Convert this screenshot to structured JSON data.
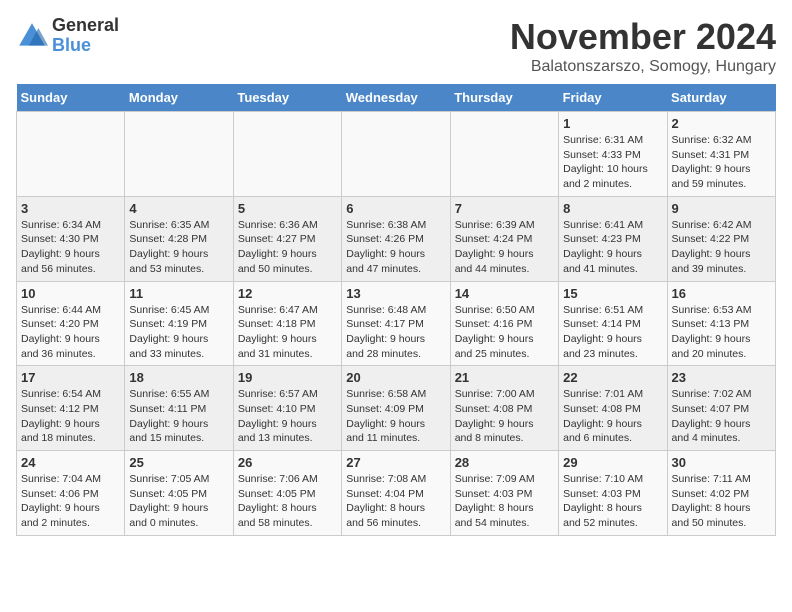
{
  "logo": {
    "general": "General",
    "blue": "Blue"
  },
  "title": "November 2024",
  "subtitle": "Balatonszarszo, Somogy, Hungary",
  "headers": [
    "Sunday",
    "Monday",
    "Tuesday",
    "Wednesday",
    "Thursday",
    "Friday",
    "Saturday"
  ],
  "weeks": [
    [
      {
        "day": "",
        "info": ""
      },
      {
        "day": "",
        "info": ""
      },
      {
        "day": "",
        "info": ""
      },
      {
        "day": "",
        "info": ""
      },
      {
        "day": "",
        "info": ""
      },
      {
        "day": "1",
        "info": "Sunrise: 6:31 AM\nSunset: 4:33 PM\nDaylight: 10 hours\nand 2 minutes."
      },
      {
        "day": "2",
        "info": "Sunrise: 6:32 AM\nSunset: 4:31 PM\nDaylight: 9 hours\nand 59 minutes."
      }
    ],
    [
      {
        "day": "3",
        "info": "Sunrise: 6:34 AM\nSunset: 4:30 PM\nDaylight: 9 hours\nand 56 minutes."
      },
      {
        "day": "4",
        "info": "Sunrise: 6:35 AM\nSunset: 4:28 PM\nDaylight: 9 hours\nand 53 minutes."
      },
      {
        "day": "5",
        "info": "Sunrise: 6:36 AM\nSunset: 4:27 PM\nDaylight: 9 hours\nand 50 minutes."
      },
      {
        "day": "6",
        "info": "Sunrise: 6:38 AM\nSunset: 4:26 PM\nDaylight: 9 hours\nand 47 minutes."
      },
      {
        "day": "7",
        "info": "Sunrise: 6:39 AM\nSunset: 4:24 PM\nDaylight: 9 hours\nand 44 minutes."
      },
      {
        "day": "8",
        "info": "Sunrise: 6:41 AM\nSunset: 4:23 PM\nDaylight: 9 hours\nand 41 minutes."
      },
      {
        "day": "9",
        "info": "Sunrise: 6:42 AM\nSunset: 4:22 PM\nDaylight: 9 hours\nand 39 minutes."
      }
    ],
    [
      {
        "day": "10",
        "info": "Sunrise: 6:44 AM\nSunset: 4:20 PM\nDaylight: 9 hours\nand 36 minutes."
      },
      {
        "day": "11",
        "info": "Sunrise: 6:45 AM\nSunset: 4:19 PM\nDaylight: 9 hours\nand 33 minutes."
      },
      {
        "day": "12",
        "info": "Sunrise: 6:47 AM\nSunset: 4:18 PM\nDaylight: 9 hours\nand 31 minutes."
      },
      {
        "day": "13",
        "info": "Sunrise: 6:48 AM\nSunset: 4:17 PM\nDaylight: 9 hours\nand 28 minutes."
      },
      {
        "day": "14",
        "info": "Sunrise: 6:50 AM\nSunset: 4:16 PM\nDaylight: 9 hours\nand 25 minutes."
      },
      {
        "day": "15",
        "info": "Sunrise: 6:51 AM\nSunset: 4:14 PM\nDaylight: 9 hours\nand 23 minutes."
      },
      {
        "day": "16",
        "info": "Sunrise: 6:53 AM\nSunset: 4:13 PM\nDaylight: 9 hours\nand 20 minutes."
      }
    ],
    [
      {
        "day": "17",
        "info": "Sunrise: 6:54 AM\nSunset: 4:12 PM\nDaylight: 9 hours\nand 18 minutes."
      },
      {
        "day": "18",
        "info": "Sunrise: 6:55 AM\nSunset: 4:11 PM\nDaylight: 9 hours\nand 15 minutes."
      },
      {
        "day": "19",
        "info": "Sunrise: 6:57 AM\nSunset: 4:10 PM\nDaylight: 9 hours\nand 13 minutes."
      },
      {
        "day": "20",
        "info": "Sunrise: 6:58 AM\nSunset: 4:09 PM\nDaylight: 9 hours\nand 11 minutes."
      },
      {
        "day": "21",
        "info": "Sunrise: 7:00 AM\nSunset: 4:08 PM\nDaylight: 9 hours\nand 8 minutes."
      },
      {
        "day": "22",
        "info": "Sunrise: 7:01 AM\nSunset: 4:08 PM\nDaylight: 9 hours\nand 6 minutes."
      },
      {
        "day": "23",
        "info": "Sunrise: 7:02 AM\nSunset: 4:07 PM\nDaylight: 9 hours\nand 4 minutes."
      }
    ],
    [
      {
        "day": "24",
        "info": "Sunrise: 7:04 AM\nSunset: 4:06 PM\nDaylight: 9 hours\nand 2 minutes."
      },
      {
        "day": "25",
        "info": "Sunrise: 7:05 AM\nSunset: 4:05 PM\nDaylight: 9 hours\nand 0 minutes."
      },
      {
        "day": "26",
        "info": "Sunrise: 7:06 AM\nSunset: 4:05 PM\nDaylight: 8 hours\nand 58 minutes."
      },
      {
        "day": "27",
        "info": "Sunrise: 7:08 AM\nSunset: 4:04 PM\nDaylight: 8 hours\nand 56 minutes."
      },
      {
        "day": "28",
        "info": "Sunrise: 7:09 AM\nSunset: 4:03 PM\nDaylight: 8 hours\nand 54 minutes."
      },
      {
        "day": "29",
        "info": "Sunrise: 7:10 AM\nSunset: 4:03 PM\nDaylight: 8 hours\nand 52 minutes."
      },
      {
        "day": "30",
        "info": "Sunrise: 7:11 AM\nSunset: 4:02 PM\nDaylight: 8 hours\nand 50 minutes."
      }
    ]
  ]
}
